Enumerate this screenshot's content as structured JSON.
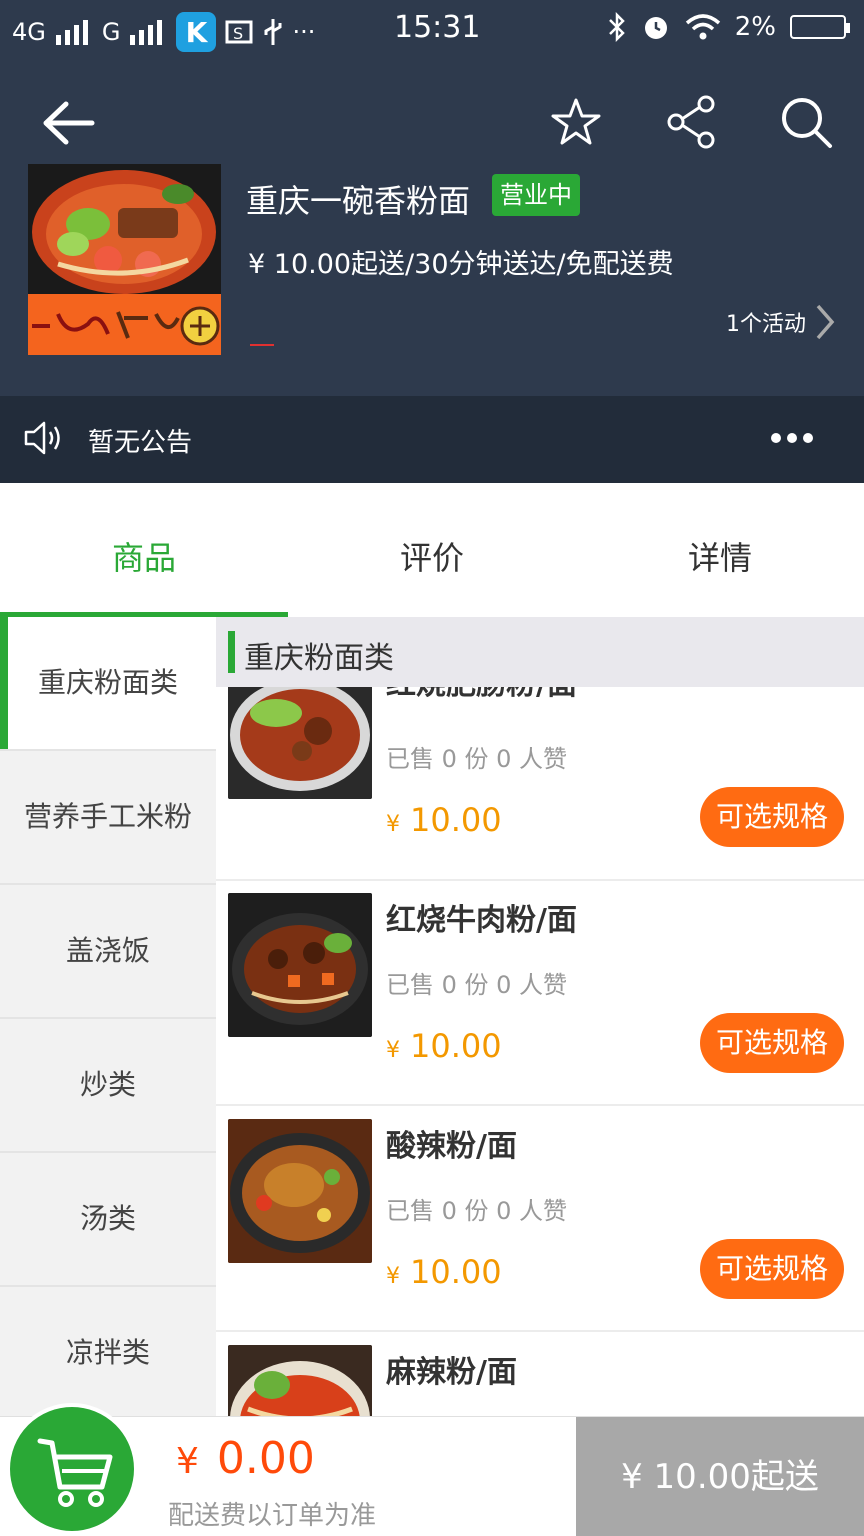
{
  "status_bar": {
    "network1": "4G",
    "network2": "G",
    "app_badge": "K",
    "time": "15:31",
    "battery": "2%"
  },
  "store": {
    "name": "重庆一碗香粉面",
    "status": "营业中",
    "delivery_info": "¥ 10.00起送/30分钟送达/免配送费",
    "activity": "1个活动"
  },
  "notice": {
    "text": "暂无公告"
  },
  "tabs": [
    {
      "label": "商品",
      "active": true
    },
    {
      "label": "评价",
      "active": false
    },
    {
      "label": "详情",
      "active": false
    }
  ],
  "categories": [
    {
      "label": "重庆粉面类",
      "active": true
    },
    {
      "label": "营养手工米粉",
      "active": false
    },
    {
      "label": "盖浇饭",
      "active": false
    },
    {
      "label": "炒类",
      "active": false
    },
    {
      "label": "汤类",
      "active": false
    },
    {
      "label": "凉拌类",
      "active": false
    }
  ],
  "section": {
    "title": "重庆粉面类"
  },
  "items": [
    {
      "name": "红烧肥肠粉/面",
      "stats": "已售 0 份   0 人赞",
      "yen": "¥",
      "price": "10.00",
      "button": "可选规格"
    },
    {
      "name": "红烧牛肉粉/面",
      "stats": "已售 0 份   0 人赞",
      "yen": "¥",
      "price": "10.00",
      "button": "可选规格"
    },
    {
      "name": "酸辣粉/面",
      "stats": "已售 0 份   0 人赞",
      "yen": "¥",
      "price": "10.00",
      "button": "可选规格"
    },
    {
      "name": "麻辣粉/面",
      "stats": "",
      "yen": "",
      "price": "",
      "button": ""
    }
  ],
  "cart": {
    "yen": "¥",
    "total": "0.00",
    "fee_note": "配送费以订单为准",
    "checkout_label": "¥  10.00起送"
  },
  "colors": {
    "header_bg": "#2e3a4d",
    "accent_green": "#2aa836",
    "orange_button": "#ff6b12",
    "price_color": "#f39800",
    "total_color": "#ff4a0a",
    "checkout_bg": "#a8a8a8"
  }
}
